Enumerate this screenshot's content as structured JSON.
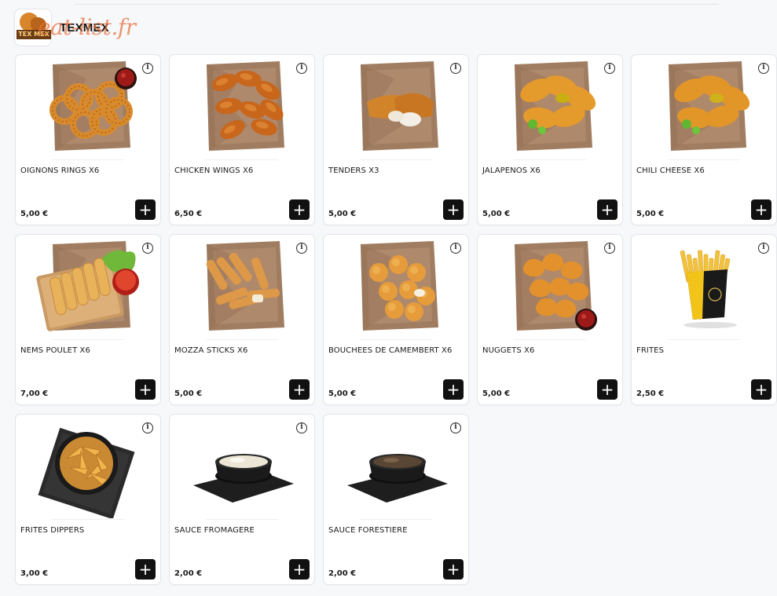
{
  "category": {
    "title": "TEXMEX",
    "logo_text": "TEX MEX",
    "watermark": "eat-list.fr"
  },
  "add_icon": "plus-icon",
  "info_icon": "info-icon",
  "info_glyph": "i",
  "add_glyph": "+",
  "products": [
    {
      "name": "OIGNONS RINGS X6",
      "price": "5,00 €",
      "image": "onion-rings"
    },
    {
      "name": "CHICKEN WINGS X6",
      "price": "6,50 €",
      "image": "chicken-wings"
    },
    {
      "name": "TENDERS X3",
      "price": "5,00 €",
      "image": "tenders"
    },
    {
      "name": "JALAPENOS X6",
      "price": "5,00 €",
      "image": "jalapenos"
    },
    {
      "name": "CHILI CHEESE X6",
      "price": "5,00 €",
      "image": "chili-cheese"
    },
    {
      "name": "NEMS POULET X6",
      "price": "7,00 €",
      "image": "nems"
    },
    {
      "name": "MOZZA STICKS X6",
      "price": "5,00 €",
      "image": "mozza-sticks"
    },
    {
      "name": "BOUCHEES DE CAMEMBERT X6",
      "price": "5,00 €",
      "image": "camembert"
    },
    {
      "name": "NUGGETS X6",
      "price": "5,00 €",
      "image": "nuggets"
    },
    {
      "name": "FRITES",
      "price": "2,50 €",
      "image": "fries"
    },
    {
      "name": "FRITES DIPPERS",
      "price": "3,00 €",
      "image": "potato-wedges"
    },
    {
      "name": "SAUCE FROMAGERE",
      "price": "2,00 €",
      "image": "cheese-sauce"
    },
    {
      "name": "SAUCE FORESTIERE",
      "price": "2,00 €",
      "image": "mushroom-sauce"
    }
  ],
  "colors": {
    "accent": "#111111",
    "paper": "#a07d61",
    "fried": "#d98a2c",
    "watermark": "#e86e37"
  }
}
